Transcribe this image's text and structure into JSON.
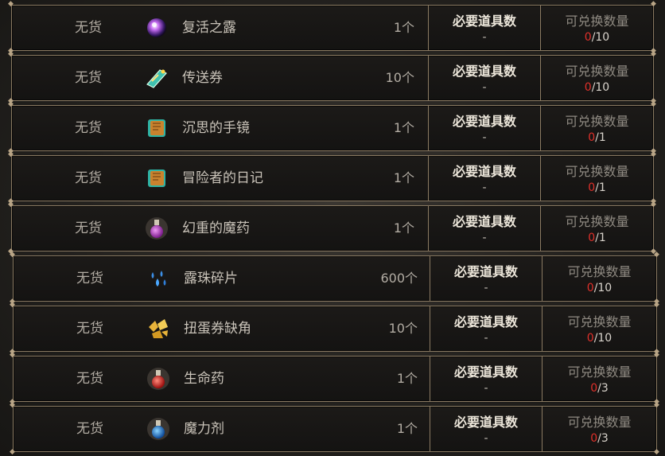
{
  "rows": [
    {
      "stock": "无货",
      "name": "复活之露",
      "qty": "1个",
      "req_label": "必要道具数",
      "req_value": "-",
      "ex_label": "可兑换数量",
      "ex_current": "0",
      "ex_max": "/10",
      "icon": "purple-orb-icon"
    },
    {
      "stock": "无货",
      "name": "传送券",
      "qty": "10个",
      "req_label": "必要道具数",
      "req_value": "-",
      "ex_label": "可兑换数量",
      "ex_current": "0",
      "ex_max": "/10",
      "icon": "teleport-ticket-icon"
    },
    {
      "stock": "无货",
      "name": "沉思的手镜",
      "qty": "1个",
      "req_label": "必要道具数",
      "req_value": "-",
      "ex_label": "可兑换数量",
      "ex_current": "0",
      "ex_max": "/1",
      "icon": "book-icon"
    },
    {
      "stock": "无货",
      "name": "冒险者的日记",
      "qty": "1个",
      "req_label": "必要道具数",
      "req_value": "-",
      "ex_label": "可兑换数量",
      "ex_current": "0",
      "ex_max": "/1",
      "icon": "book-icon"
    },
    {
      "stock": "无货",
      "name": "幻重的魔药",
      "qty": "1个",
      "req_label": "必要道具数",
      "req_value": "-",
      "ex_label": "可兑换数量",
      "ex_current": "0",
      "ex_max": "/1",
      "icon": "purple-potion-icon"
    },
    {
      "stock": "无货",
      "name": "露珠碎片",
      "qty": "600个",
      "req_label": "必要道具数",
      "req_value": "-",
      "ex_label": "可兑换数量",
      "ex_current": "0",
      "ex_max": "/10",
      "icon": "blue-droplets-icon"
    },
    {
      "stock": "无货",
      "name": "扭蛋券缺角",
      "qty": "10个",
      "req_label": "必要道具数",
      "req_value": "-",
      "ex_label": "可兑换数量",
      "ex_current": "0",
      "ex_max": "/10",
      "icon": "gold-fragments-icon"
    },
    {
      "stock": "无货",
      "name": "生命药",
      "qty": "1个",
      "req_label": "必要道具数",
      "req_value": "-",
      "ex_label": "可兑换数量",
      "ex_current": "0",
      "ex_max": "/3",
      "icon": "red-potion-icon"
    },
    {
      "stock": "无货",
      "name": "魔力剂",
      "qty": "1个",
      "req_label": "必要道具数",
      "req_value": "-",
      "ex_label": "可兑换数量",
      "ex_current": "0",
      "ex_max": "/3",
      "icon": "blue-potion-icon"
    }
  ],
  "colors": {
    "border": "#8a7a62",
    "current_count": "#e0302a"
  }
}
